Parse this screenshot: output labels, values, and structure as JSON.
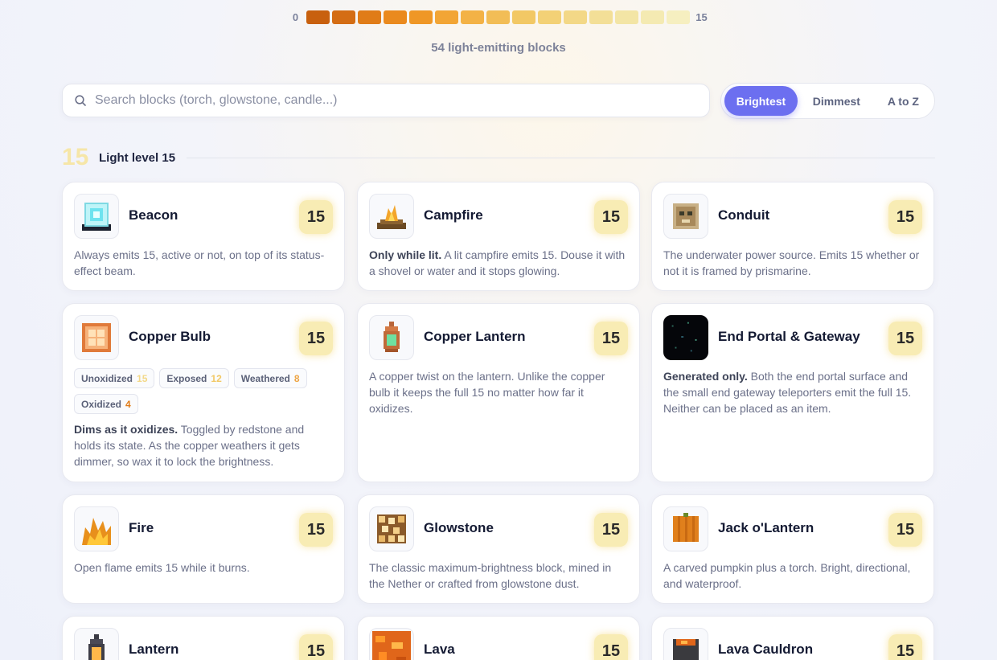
{
  "scale": {
    "min": "0",
    "max": "15",
    "colors": [
      "#c8600e",
      "#d46d14",
      "#e07c18",
      "#ea8a1e",
      "#ef9726",
      "#f2a535",
      "#f3b246",
      "#f2bd56",
      "#f2c865",
      "#f3d176",
      "#f3d887",
      "#f3df97",
      "#f3e5a5",
      "#f4eab2",
      "#f6efc0"
    ]
  },
  "count_text": "54 light-emitting blocks",
  "search": {
    "placeholder": "Search blocks (torch, glowstone, candle...)",
    "value": ""
  },
  "sort": {
    "options": [
      "Brightest",
      "Dimmest",
      "A to Z"
    ],
    "active": "Brightest"
  },
  "section": {
    "level": "15",
    "label": "Light level 15"
  },
  "blocks": [
    {
      "name": "Beacon",
      "level": "15",
      "bold": "",
      "desc": "Always emits 15, active or not, on top of its status-effect beam.",
      "icon": "beacon-icon"
    },
    {
      "name": "Campfire",
      "level": "15",
      "bold": "Only while lit.",
      "desc": " A lit campfire emits 15. Douse it with a shovel or water and it stops glowing.",
      "icon": "campfire-icon"
    },
    {
      "name": "Conduit",
      "level": "15",
      "bold": "",
      "desc": "The underwater power source. Emits 15 whether or not it is framed by prismarine.",
      "icon": "conduit-icon"
    },
    {
      "name": "Copper Bulb",
      "level": "15",
      "bold": "Dims as it oxidizes.",
      "desc": " Toggled by redstone and holds its state. As the copper weathers it gets dimmer, so wax it to lock the brightness.",
      "icon": "copper-bulb-icon",
      "chips": [
        {
          "label": "Unoxidized",
          "value": "15",
          "color": "#f3d887"
        },
        {
          "label": "Exposed",
          "value": "12",
          "color": "#f2c865"
        },
        {
          "label": "Weathered",
          "value": "8",
          "color": "#eea544"
        },
        {
          "label": "Oxidized",
          "value": "4",
          "color": "#e07c18"
        }
      ]
    },
    {
      "name": "Copper Lantern",
      "level": "15",
      "bold": "",
      "desc": "A copper twist on the lantern. Unlike the copper bulb it keeps the full 15 no matter how far it oxidizes.",
      "icon": "copper-lantern-icon"
    },
    {
      "name": "End Portal & Gateway",
      "level": "15",
      "bold": "Generated only.",
      "desc": " Both the end portal surface and the small end gateway teleporters emit the full 15. Neither can be placed as an item.",
      "icon": "end-portal-icon"
    },
    {
      "name": "Fire",
      "level": "15",
      "bold": "",
      "desc": "Open flame emits 15 while it burns.",
      "icon": "fire-icon"
    },
    {
      "name": "Glowstone",
      "level": "15",
      "bold": "",
      "desc": "The classic maximum-brightness block, mined in the Nether or crafted from glowstone dust.",
      "icon": "glowstone-icon"
    },
    {
      "name": "Jack o'Lantern",
      "level": "15",
      "bold": "",
      "desc": "A carved pumpkin plus a torch. Bright, directional, and waterproof.",
      "icon": "jack-o-lantern-icon"
    },
    {
      "name": "Lantern",
      "level": "15",
      "bold": "",
      "desc": "",
      "icon": "lantern-icon"
    },
    {
      "name": "Lava",
      "level": "15",
      "bold": "",
      "desc": "",
      "icon": "lava-icon"
    },
    {
      "name": "Lava Cauldron",
      "level": "15",
      "bold": "",
      "desc": "",
      "icon": "lava-cauldron-icon"
    }
  ]
}
